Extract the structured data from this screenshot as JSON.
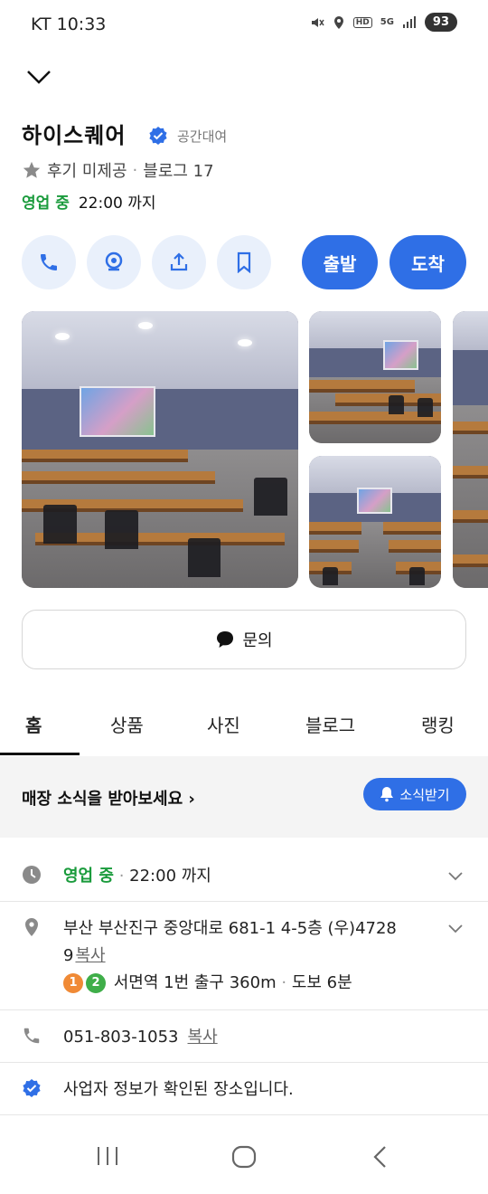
{
  "status_bar": {
    "carrier": "KT 10:33",
    "network": "5G",
    "hd": "HD",
    "battery": "93"
  },
  "place": {
    "name": "하이스퀘어",
    "category": "공간대여",
    "review_status": "후기 미제공",
    "blog_reviews": "블로그 17",
    "open_status": "영업 중",
    "close_time": "22:00 까지"
  },
  "actions": {
    "depart_label": "출발",
    "arrive_label": "도착"
  },
  "inquiry": {
    "label": "문의"
  },
  "tabs": [
    "홈",
    "상품",
    "사진",
    "블로그",
    "랭킹"
  ],
  "news": {
    "text": "매장 소식을 받아보세요",
    "button_label": "소식받기"
  },
  "info": {
    "hours_status": "영업 중",
    "hours_close": "22:00 까지",
    "address_line1": "부산 부산진구 중앙대로 681-1 4-5층 (우)4728",
    "address_line2": "9",
    "copy_label": "복사",
    "subway_line1": "1",
    "subway_line2": "2",
    "subway_text": "서면역 1번 출구 360m",
    "walk_text": "도보 6분",
    "phone": "051-803-1053",
    "verified_text": "사업자 정보가 확인된 장소입니다."
  },
  "colors": {
    "accent": "#2f6fe6",
    "open_green": "#1a9b3c",
    "line1": "#f08a36",
    "line2": "#3fae49"
  }
}
